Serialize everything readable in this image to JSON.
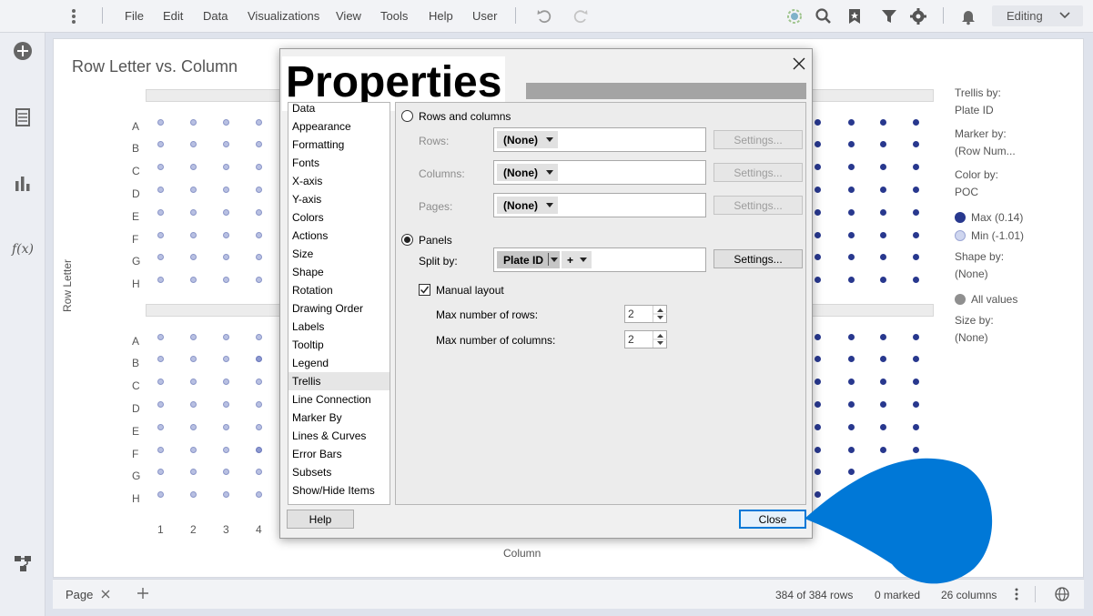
{
  "menu": {
    "items": [
      "File",
      "Edit",
      "Data",
      "Visualizations",
      "View",
      "Tools",
      "Help",
      "User"
    ],
    "mode": "Editing"
  },
  "visualization": {
    "title": "Row Letter vs. Column",
    "y_axis_title": "Row Letter",
    "x_axis_title": "Column",
    "row_labels": [
      "A",
      "B",
      "C",
      "D",
      "E",
      "F",
      "G",
      "H"
    ],
    "col_labels": [
      "1",
      "2",
      "3",
      "4"
    ]
  },
  "legend": {
    "trellis_by_label": "Trellis by:",
    "trellis_by_value": "Plate ID",
    "marker_by_label": "Marker by:",
    "marker_by_value": "(Row Num...",
    "color_by_label": "Color by:",
    "color_by_value": "POC",
    "max_label": "Max (0.14)",
    "min_label": "Min (-1.01)",
    "shape_by_label": "Shape by:",
    "shape_by_value": "(None)",
    "all_values_label": "All values",
    "size_by_label": "Size by:",
    "size_by_value": "(None)",
    "colors": {
      "max": "#28388e",
      "min": "#cfd6ef",
      "all": "#8f8f8f"
    }
  },
  "status": {
    "tab_label": "Page",
    "rows": "384 of 384 rows",
    "marked": "0 marked",
    "columns": "26 columns"
  },
  "dialog": {
    "title": "Properties",
    "nav_items": [
      "Data",
      "Appearance",
      "Formatting",
      "Fonts",
      "X-axis",
      "Y-axis",
      "Colors",
      "Actions",
      "Size",
      "Shape",
      "Rotation",
      "Drawing Order",
      "Labels",
      "Tooltip",
      "Legend",
      "Trellis",
      "Line Connection",
      "Marker By",
      "Lines & Curves",
      "Error Bars",
      "Subsets",
      "Show/Hide Items"
    ],
    "selected_nav": "Trellis",
    "rows_and_columns_label": "Rows and columns",
    "rows_label": "Rows:",
    "columns_label": "Columns:",
    "pages_label": "Pages:",
    "rows_value": "(None)",
    "columns_value": "(None)",
    "pages_value": "(None)",
    "settings_label": "Settings...",
    "panels_label": "Panels",
    "split_by_label": "Split by:",
    "split_by_value": "Plate ID",
    "add_label": "+",
    "manual_layout_label": "Manual layout",
    "max_rows_label": "Max number of rows:",
    "max_rows_value": "2",
    "max_columns_label": "Max number of columns:",
    "max_columns_value": "2",
    "help_label": "Help",
    "close_label": "Close"
  },
  "colors": {
    "accent": "#0078d7"
  }
}
